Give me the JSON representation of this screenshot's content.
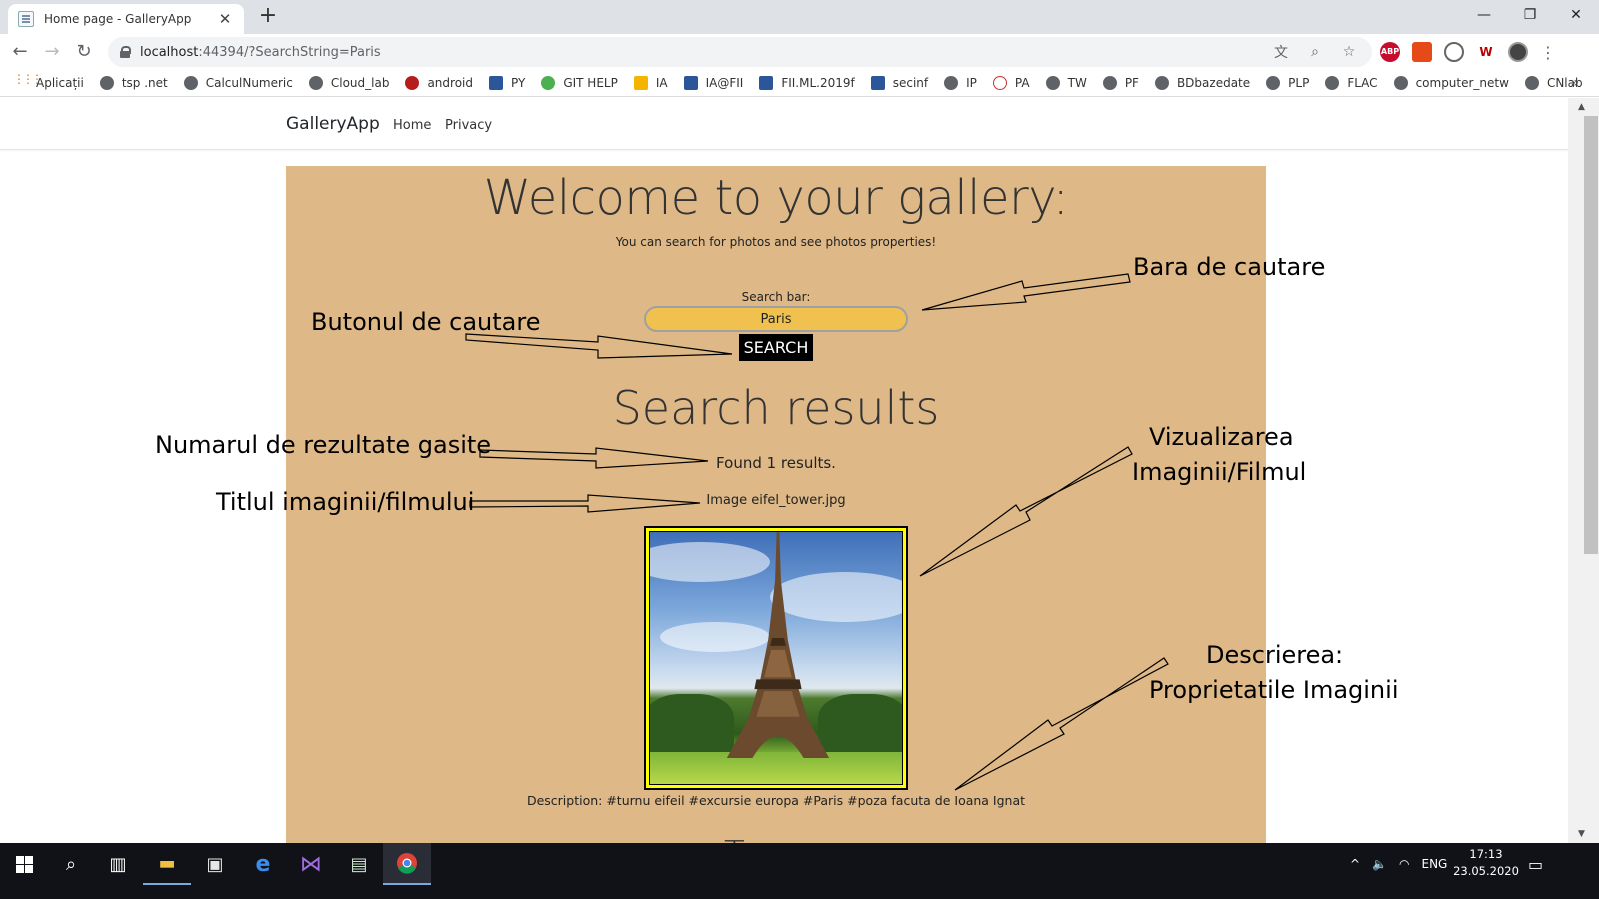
{
  "browser": {
    "tab_title": "Home page - GalleryApp",
    "tab_close": "✕",
    "new_tab": "+",
    "url_host": "localhost",
    "url_path": ":44394/?SearchString=Paris",
    "window_controls": [
      "—",
      "❐",
      "✕"
    ],
    "bookmarks": [
      {
        "label": "Aplicații",
        "icon": "apps-grid-icon"
      },
      {
        "label": "tsp .net",
        "icon": "globe-icon"
      },
      {
        "label": "CalculNumeric",
        "icon": "globe-icon"
      },
      {
        "label": "Cloud_lab",
        "icon": "globe-icon"
      },
      {
        "label": "android",
        "icon": "apple-icon"
      },
      {
        "label": "PY",
        "icon": "form-icon"
      },
      {
        "label": "GIT HELP",
        "icon": "leaf-icon"
      },
      {
        "label": "IA",
        "icon": "slides-icon"
      },
      {
        "label": "IA@FII",
        "icon": "form-icon"
      },
      {
        "label": "FII.ML.2019f",
        "icon": "p-icon"
      },
      {
        "label": "secinf",
        "icon": "form-icon"
      },
      {
        "label": "IP",
        "icon": "globe-icon"
      },
      {
        "label": "PA",
        "icon": "java-icon"
      },
      {
        "label": "TW",
        "icon": "globe-icon"
      },
      {
        "label": "PF",
        "icon": "globe-icon"
      },
      {
        "label": "BDbazedate",
        "icon": "globe-icon"
      },
      {
        "label": "PLP",
        "icon": "globe-icon"
      },
      {
        "label": "FLAC",
        "icon": "globe-icon"
      },
      {
        "label": "computer_netw",
        "icon": "globe-icon"
      },
      {
        "label": "CNlab",
        "icon": "globe-icon"
      }
    ],
    "bookmarks_more": "»",
    "extensions": [
      "ABP",
      "",
      "",
      "W",
      ""
    ]
  },
  "app": {
    "brand": "GalleryApp",
    "nav": [
      "Home",
      "Privacy"
    ],
    "welcome": "Welcome to your gallery:",
    "subtitle": "You can search for photos and see photos properties!",
    "search_label": "Search bar:",
    "search_value": "Paris",
    "search_button": "SEARCH",
    "results_title": "Search results",
    "found_text": "Found 1 results.",
    "image_title": "Image eifel_tower.jpg",
    "description": "Description: #turnu eifeil #excursie europa #Paris #poza facuta de Ioana Ignat",
    "next_peek": "T"
  },
  "annotations": {
    "search_bar": "Bara de cautare",
    "search_button": "Butonul de cautare",
    "result_count": "Numarul de rezultate gasite",
    "title": "Titlul imaginii/filmului",
    "view_line1": "Vizualizarea",
    "view_line2": "Imaginii/Filmul",
    "desc_line1": "Descrierea:",
    "desc_line2": "Proprietatile Imaginii"
  },
  "taskbar": {
    "tray_lang": "ENG",
    "time": "17:13",
    "date": "23.05.2020"
  },
  "colors": {
    "panel": "#deb887",
    "search_input": "#f0c14f",
    "photo_frame": "#ffff00",
    "search_button": "#000000"
  }
}
